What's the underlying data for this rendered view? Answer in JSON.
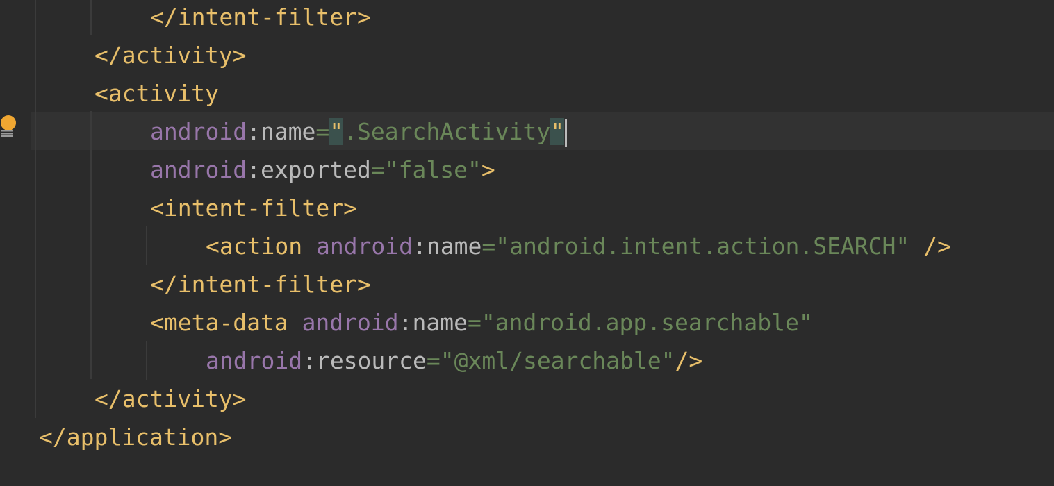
{
  "editor": {
    "language": "xml",
    "lines": [
      {
        "indent": 2,
        "parts": [
          "</intent-filter>"
        ]
      },
      {
        "indent": 1,
        "parts": [
          "</activity>"
        ]
      },
      {
        "indent": 1,
        "parts": [
          "<activity"
        ]
      },
      {
        "indent": 2,
        "parts": [
          "android",
          ":name",
          "=",
          "\"",
          ".SearchActivity",
          "\""
        ]
      },
      {
        "indent": 2,
        "parts": [
          "android",
          ":exported",
          "=",
          "\"false\"",
          ">"
        ]
      },
      {
        "indent": 2,
        "parts": [
          "<intent-filter>"
        ]
      },
      {
        "indent": 3,
        "parts": [
          "<action",
          "android",
          ":name",
          "=",
          "\"android.intent.action.SEARCH\"",
          "/>"
        ]
      },
      {
        "indent": 2,
        "parts": [
          "</intent-filter>"
        ]
      },
      {
        "indent": 2,
        "parts": [
          "<meta-data",
          "android",
          ":name",
          "=",
          "\"android.app.searchable\""
        ]
      },
      {
        "indent": 3,
        "parts": [
          "android",
          ":resource",
          "=",
          "\"@xml/searchable\"",
          "/>"
        ]
      },
      {
        "indent": 1,
        "parts": [
          "</activity>"
        ]
      },
      {
        "indent": 0,
        "parts": [
          "</application>"
        ]
      }
    ]
  },
  "gutter": {
    "intention_icon": "lightbulb-icon"
  },
  "colors": {
    "background": "#2b2b2b",
    "current_line": "#323232",
    "tag": "#e8bf6a",
    "namespace": "#9876aa",
    "attribute": "#bababa",
    "value": "#6a8759",
    "bulb": "#f0a732"
  }
}
